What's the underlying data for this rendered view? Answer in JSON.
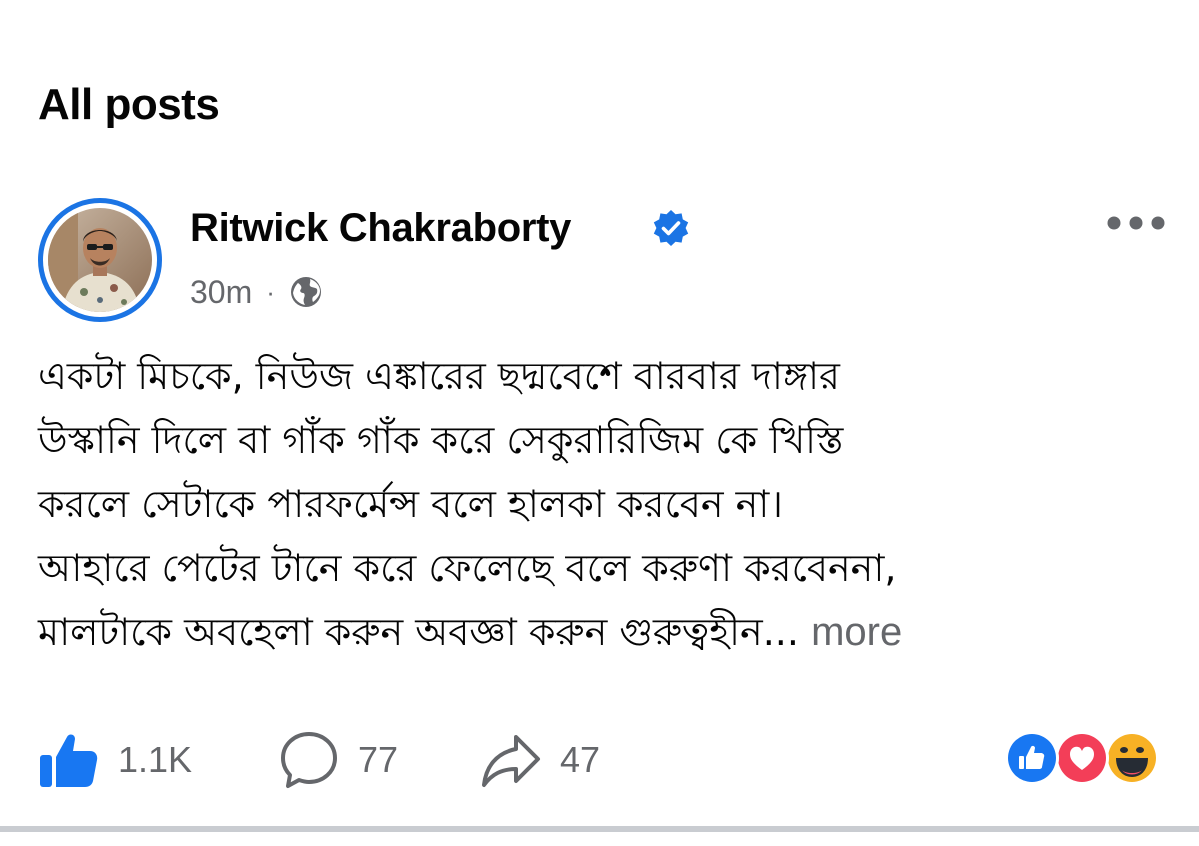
{
  "section": {
    "title": "All posts"
  },
  "post": {
    "author": "Ritwick Chakraborty",
    "verified": true,
    "timestamp": "30m",
    "separator": "·",
    "audience_icon": "globe-icon",
    "body_lines": [
      "একটা মিচকে, নিউজ এঙ্কারের ছদ্মবেশে বারবার দাঙ্গার",
      "উস্কানি দিলে বা গাঁক গাঁক করে সেকুরারিজিম কে খিস্তি",
      "করলে সেটাকে পারফর্মেন্স বলে হালকা করবেন না।",
      "আহারে পেটের টানে করে ফেলেছে বলে করুণা করবেননা,",
      "মালটাকে অবহেলা করুন অবজ্ঞা করুন গুরুত্বহীন..."
    ],
    "see_more": "more"
  },
  "actions": {
    "like_count": "1.1K",
    "comment_count": "77",
    "share_count": "47"
  },
  "reactions": [
    "like",
    "love",
    "haha"
  ],
  "colors": {
    "accent": "#1b74e4",
    "like": "#1877f2",
    "love": "#f33e58",
    "haha": "#f7b125",
    "secondary_text": "#65676b"
  }
}
